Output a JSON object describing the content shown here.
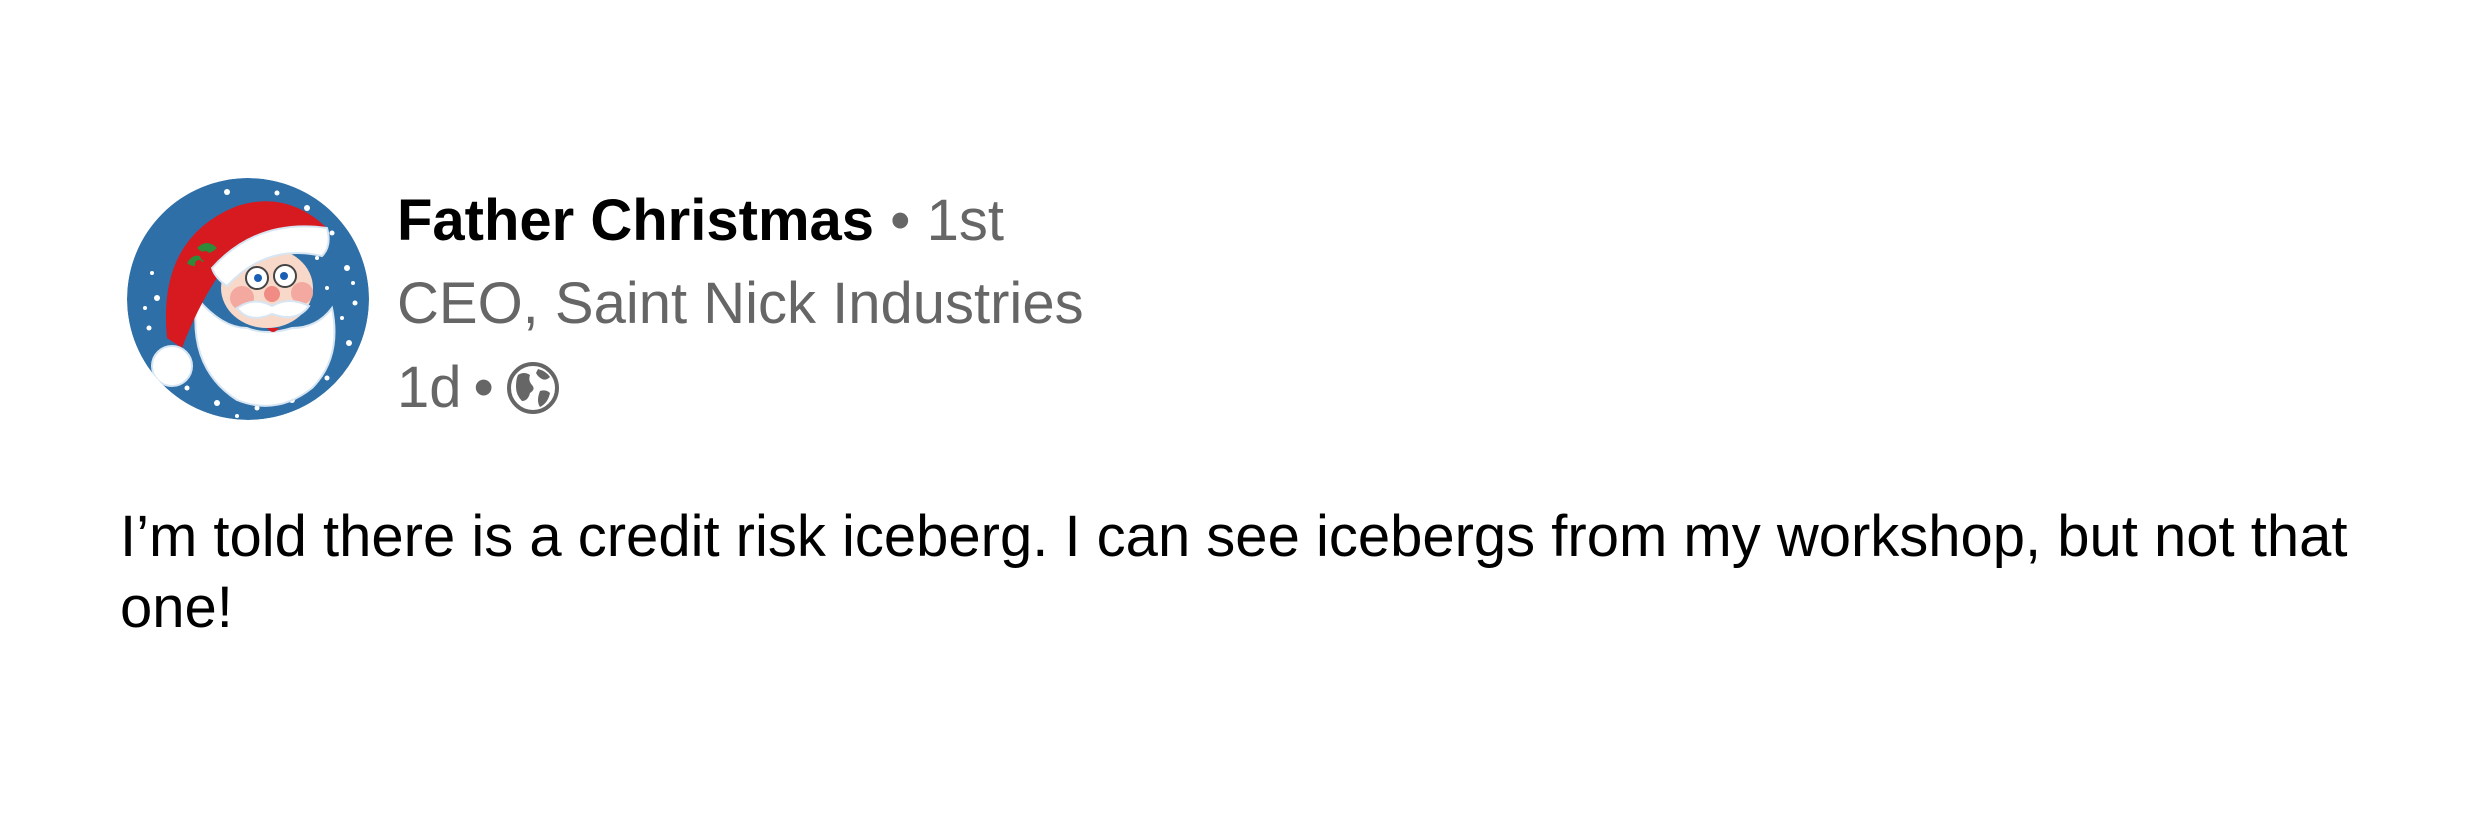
{
  "post": {
    "author": {
      "name": "Father Christmas",
      "separator": "•",
      "connection_degree": "1st",
      "headline": "CEO, Saint Nick Industries",
      "avatar_icon": "santa-claus-avatar"
    },
    "meta": {
      "time_ago": "1d",
      "separator": "•",
      "visibility_icon": "globe-icon"
    },
    "text": "I’m told there is a credit risk iceberg. I can see icebergs from my workshop, but not that one!"
  },
  "colors": {
    "text_primary": "#000000",
    "text_secondary": "#666666",
    "avatar_background": "#2f6fa8",
    "hat_red": "#d71920"
  }
}
